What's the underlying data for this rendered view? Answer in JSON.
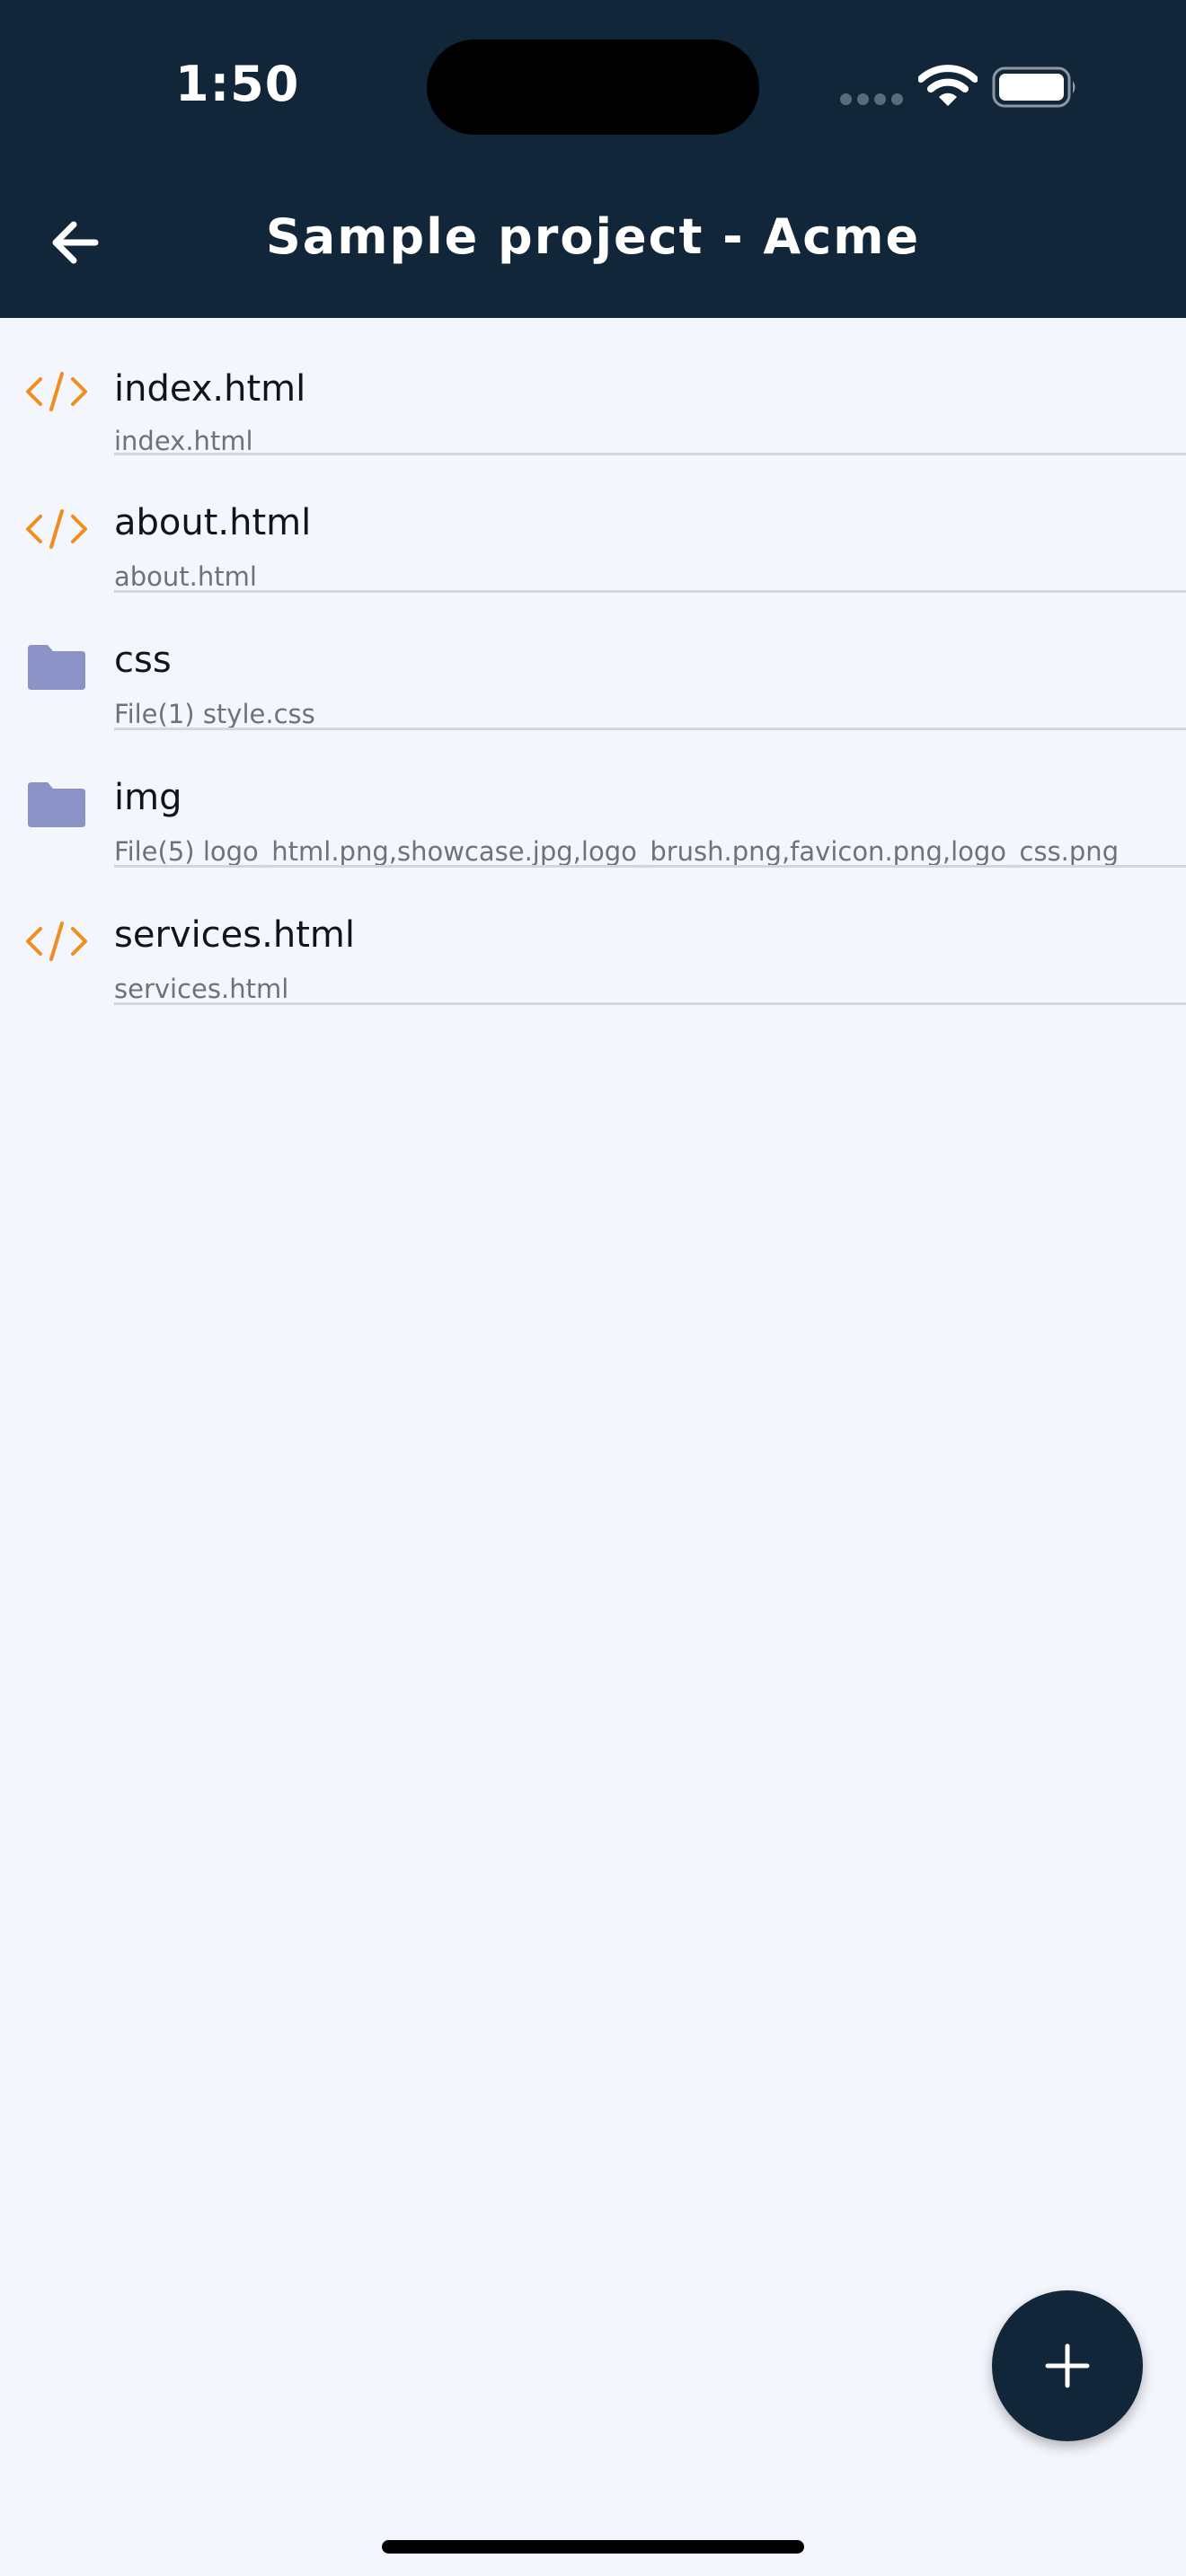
{
  "status_bar": {
    "time": "1:50"
  },
  "header": {
    "title": "Sample project - Acme",
    "background_color": "#12263a",
    "back_icon": "arrow-left-icon"
  },
  "files": [
    {
      "type": "html",
      "icon": "code-icon",
      "name": "index.html",
      "detail": "index.html"
    },
    {
      "type": "html",
      "icon": "code-icon",
      "name": "about.html",
      "detail": "about.html"
    },
    {
      "type": "folder",
      "icon": "folder-icon",
      "name": "css",
      "detail": "File(1) style.css"
    },
    {
      "type": "folder",
      "icon": "folder-icon",
      "name": "img",
      "detail": "File(5) logo_html.png,showcase.jpg,logo_brush.png,favicon.png,logo_css.png"
    },
    {
      "type": "html",
      "icon": "code-icon",
      "name": "services.html",
      "detail": "services.html"
    }
  ],
  "fab": {
    "icon": "plus-icon"
  },
  "colors": {
    "html_icon": "#f28c1e",
    "folder_icon": "#8b93c6",
    "background": "#f4f6fd"
  }
}
